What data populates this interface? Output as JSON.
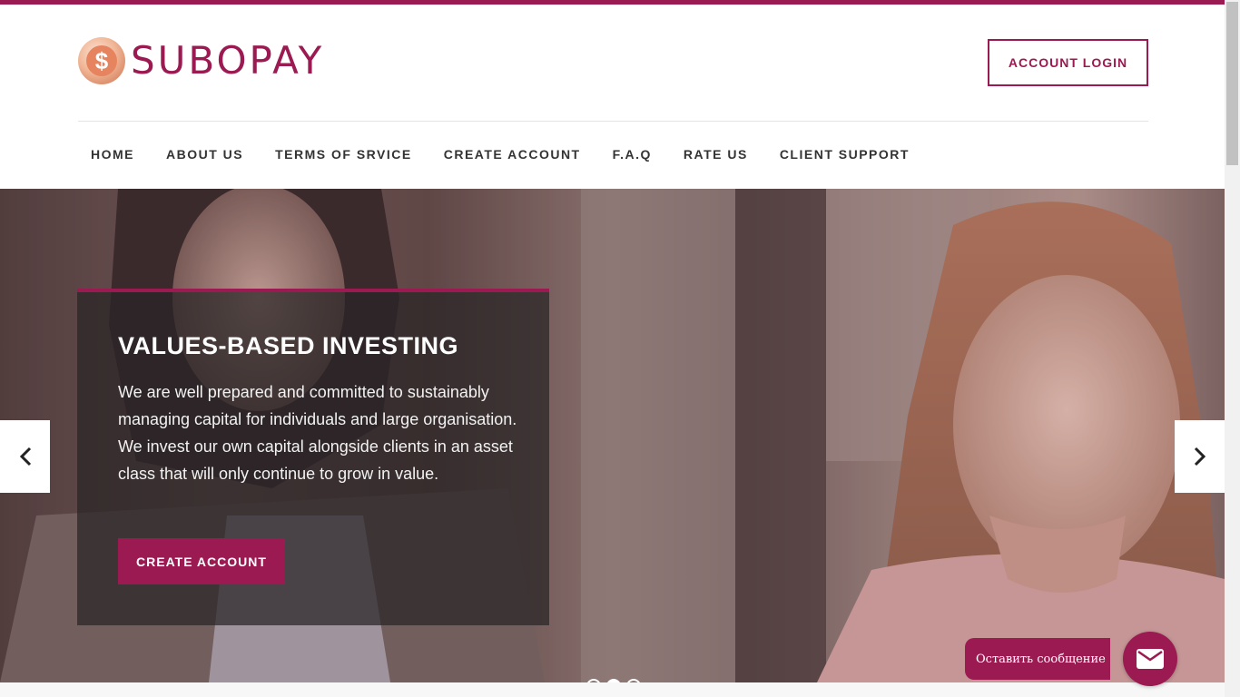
{
  "brand": {
    "name": "SUBOPAY",
    "logo_icon": "dollar-coin-icon",
    "accent_color": "#9b1a52"
  },
  "header": {
    "login_label": "ACCOUNT LOGIN"
  },
  "nav": {
    "items": [
      {
        "label": "HOME"
      },
      {
        "label": "ABOUT US"
      },
      {
        "label": "TERMS OF SRVICE"
      },
      {
        "label": "CREATE ACCOUNT"
      },
      {
        "label": "F.A.Q"
      },
      {
        "label": "RATE US"
      },
      {
        "label": "CLIENT SUPPORT"
      }
    ]
  },
  "hero": {
    "title": "VALUES-BASED INVESTING",
    "text": "We are well prepared and committed to sustainably managing capital for individuals and large organisation. We invest our own capital alongside clients in an asset class that will only continue to grow in value.",
    "cta_label": "CREATE ACCOUNT",
    "prev_icon": "chevron-left-icon",
    "next_icon": "chevron-right-icon",
    "slides_count": 3,
    "active_slide": 2
  },
  "chat": {
    "label": "Оставить сообщение",
    "icon": "envelope-icon"
  }
}
